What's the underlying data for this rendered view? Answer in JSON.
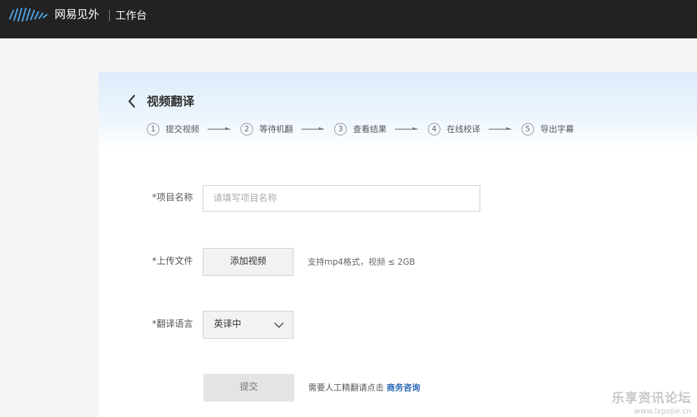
{
  "topbar": {
    "logo_icon": "netease-wave-logo-icon",
    "brand": "网易见外",
    "workspace": "工作台"
  },
  "page": {
    "back_icon": "chevron-left-icon",
    "title": "视频翻译"
  },
  "steps": [
    {
      "num": "1",
      "label": "提交视频"
    },
    {
      "num": "2",
      "label": "等待机翻"
    },
    {
      "num": "3",
      "label": "查看结果"
    },
    {
      "num": "4",
      "label": "在线校译"
    },
    {
      "num": "5",
      "label": "导出字幕"
    }
  ],
  "form": {
    "name_label": "*项目名称",
    "name_placeholder": "请填写项目名称",
    "name_value": "",
    "upload_label": "*上传文件",
    "upload_button": "添加视频",
    "upload_hint": "支持mp4格式，视频 ≤ 2GB",
    "lang_label": "*翻译语言",
    "lang_value": "英译中",
    "submit_button": "提交",
    "submit_hint": "需要人工精翻请点击",
    "consult_link": "商务咨询"
  },
  "watermark": {
    "main": "乐享资讯论坛",
    "sub": "www.lxpojie.cn"
  },
  "colors": {
    "topbar_bg": "#222222",
    "accent_link": "#2a66b5",
    "logo_blue": "#4a9fe0"
  }
}
